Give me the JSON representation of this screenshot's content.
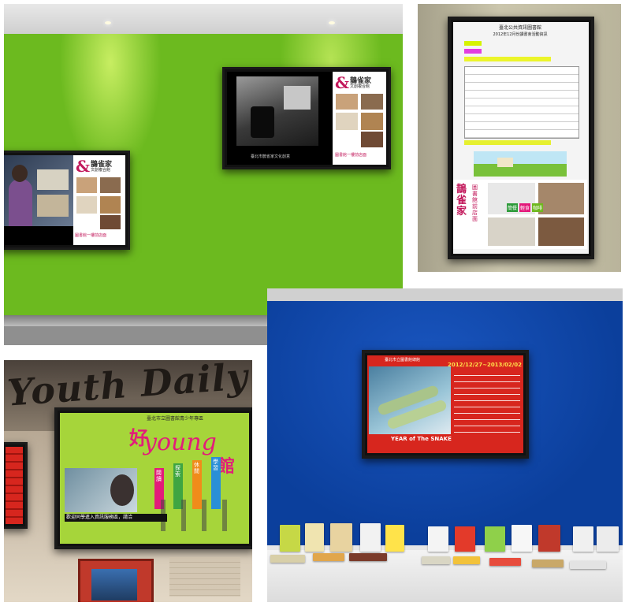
{
  "photos": [
    {
      "id": "green-wall",
      "screens": [
        {
          "brand_mark": "&",
          "brand_name": "鵲雀家",
          "brand_sub": "文創複合館",
          "caption": "圖書館一樓前店面"
        },
        {
          "brand_mark": "&",
          "brand_name": "鵲雀家",
          "brand_sub": "文創複合館",
          "caption": "圖書館一樓前店面",
          "video_caption": "臺北市鵲雀家文化創意"
        }
      ]
    },
    {
      "id": "portrait-screen",
      "screen": {
        "header_title": "臺北公共資訊圖書館",
        "header_sub": "2012年12月份讀書會活動資訊",
        "promo_vertical": "鵲雀家",
        "promo_side": "圖書館前店面",
        "tags": [
          "簡餐",
          "輕食",
          "咖啡"
        ]
      }
    },
    {
      "id": "youth-library",
      "wall_text": "Youth Daily",
      "screen": {
        "top_text": "臺北市立圖書館青少年專區",
        "title_cn_1": "好",
        "title_en": "young",
        "title_cn_2": "館",
        "tags": [
          "閱讀",
          "探索",
          "休閒",
          "學習"
        ],
        "bottom_banner": "歡迎同學進入資訊服務區，請洽"
      }
    },
    {
      "id": "blue-wall",
      "screen": {
        "header": "臺北市立圖書館總館",
        "date_range": "2012/12/27~2013/02/02",
        "year_text": "YEAR of The SNAKE"
      }
    }
  ],
  "colors": {
    "green_wall": "#6cba1f",
    "blue_wall": "#0b3f9c",
    "youth_green": "#a6d53a",
    "snake_red": "#d7261e"
  }
}
